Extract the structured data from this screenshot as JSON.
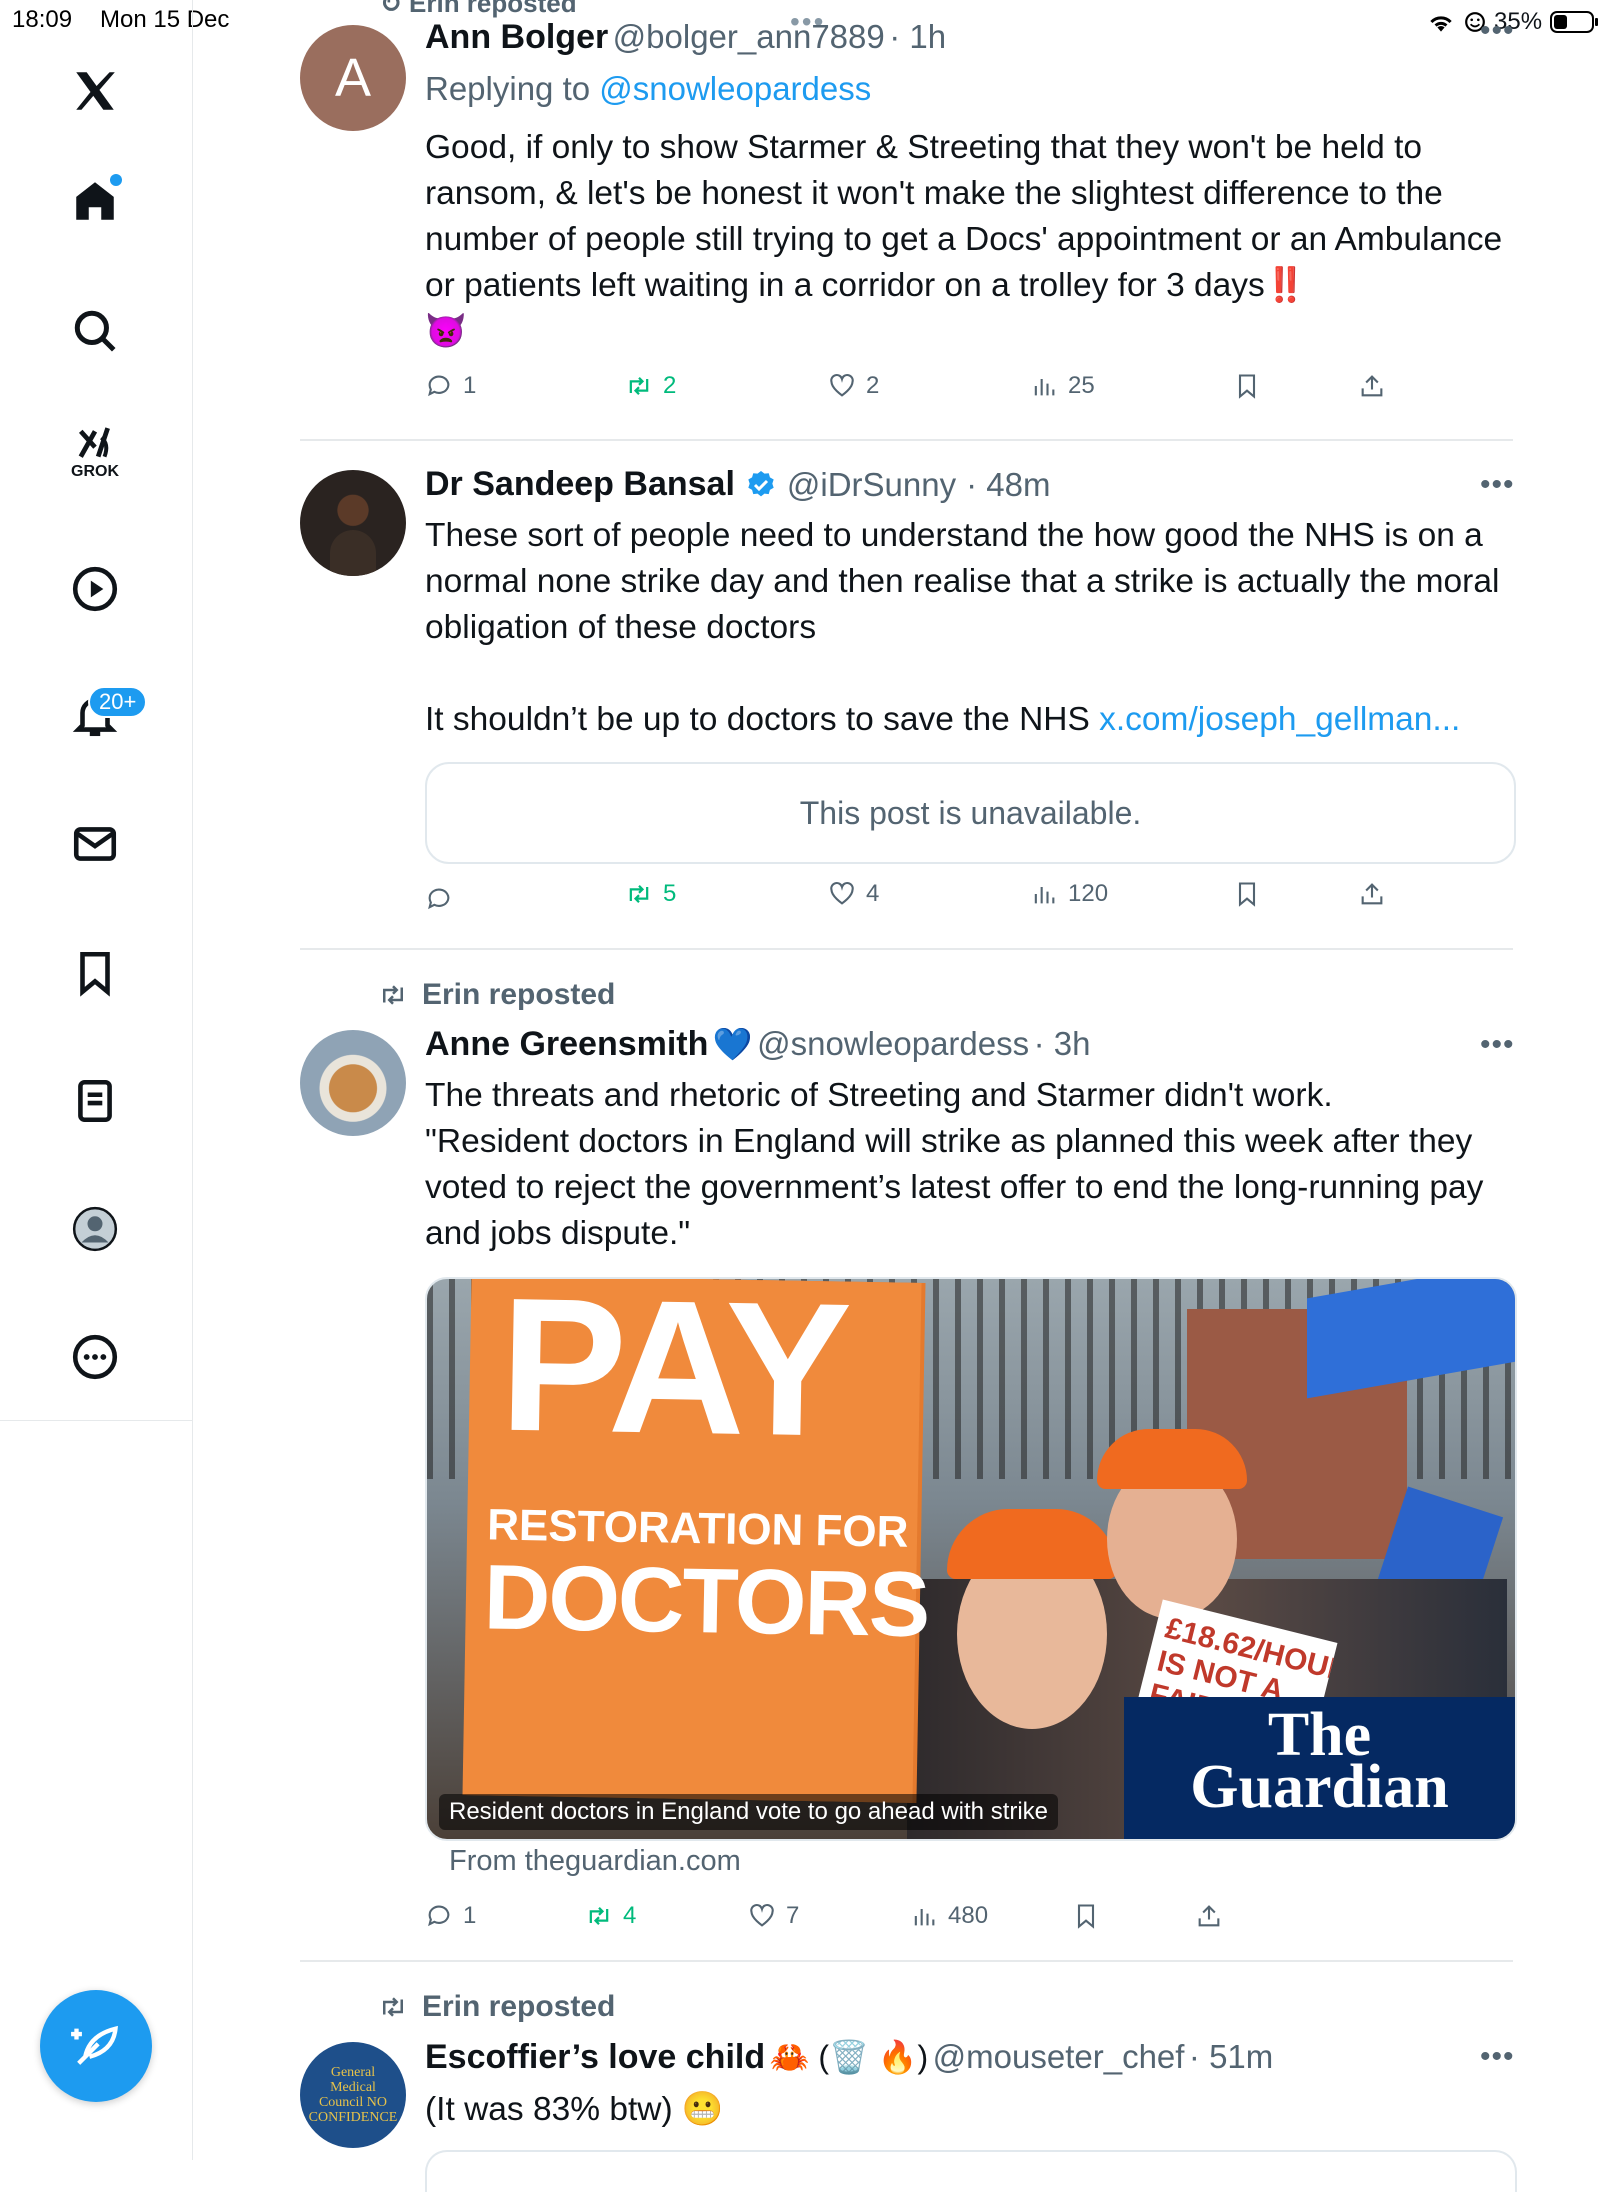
{
  "status_bar": {
    "time": "18:09",
    "date": "Mon 15 Dec",
    "battery": "35%"
  },
  "sidebar": {
    "notifications_badge": "20+",
    "grok_label": "GROK"
  },
  "posts": [
    {
      "name": "Ann Bolger",
      "handle": "@bolger_ann7889",
      "time": "· 1h",
      "avatar_letter": "A",
      "reply_prefix": "Replying to ",
      "reply_to": "@snowleopardess",
      "text": "Good, if only to show Starmer & Streeting that they won't be held to ransom, & let's be honest it won't make the slightest difference to the number of people still trying to get a Docs' appointment or an Ambulance or patients left waiting in a corridor on a trolley for 3 days‼️\n👿",
      "replies": "1",
      "reposts": "2",
      "likes": "2",
      "views": "25"
    },
    {
      "name": "Dr Sandeep Bansal",
      "handle": "@iDrSunny",
      "time": "· 48m",
      "text_main": "These sort of people need to understand the how good the NHS is on a normal none strike day and then realise that a strike is actually the moral obligation of these doctors\n\nIt shouldn’t be up to doctors to save the NHS ",
      "link": "x.com/joseph_gellman...",
      "unavailable": "This post is unavailable.",
      "replies": "",
      "reposts": "5",
      "likes": "4",
      "views": "120"
    },
    {
      "repost_label": "Erin reposted",
      "name": "Anne Greensmith",
      "name_emoji": "💙",
      "handle": "@snowleopardess",
      "time": "· 3h",
      "text": "The threats and rhetoric of Streeting and Starmer didn't work.\n\"Resident doctors in England will strike as planned this week after they voted to reject the government’s latest offer to end the long-running pay and jobs dispute.\"",
      "card": {
        "sign_big": "PAY",
        "sign_mid": "RESTORATION FOR",
        "sign_low": "DOCTORS",
        "small_sign": "£18.62/HOUR IS NOT A FAIR WAGE",
        "brand_line1": "The",
        "brand_line2": "Guardian",
        "headline": "Resident doctors in England vote to go ahead with strike",
        "source": "From theguardian.com"
      },
      "replies": "1",
      "reposts": "4",
      "likes": "7",
      "views": "480"
    },
    {
      "repost_label": "Erin reposted",
      "name": "Escoffier’s love child",
      "name_emoji": "🦀 (🗑️ 🔥)",
      "handle": "@mouseter_chef",
      "time": "· 51m",
      "avatar_text": "General Medical Council NO CONFIDENCE",
      "text": "(It was 83% btw) 😬"
    }
  ],
  "colors": {
    "accent": "#1d9bf0",
    "repost": "#00ba7c",
    "muted": "#536471",
    "guardian": "#052962",
    "sign": "#f08a3c"
  }
}
